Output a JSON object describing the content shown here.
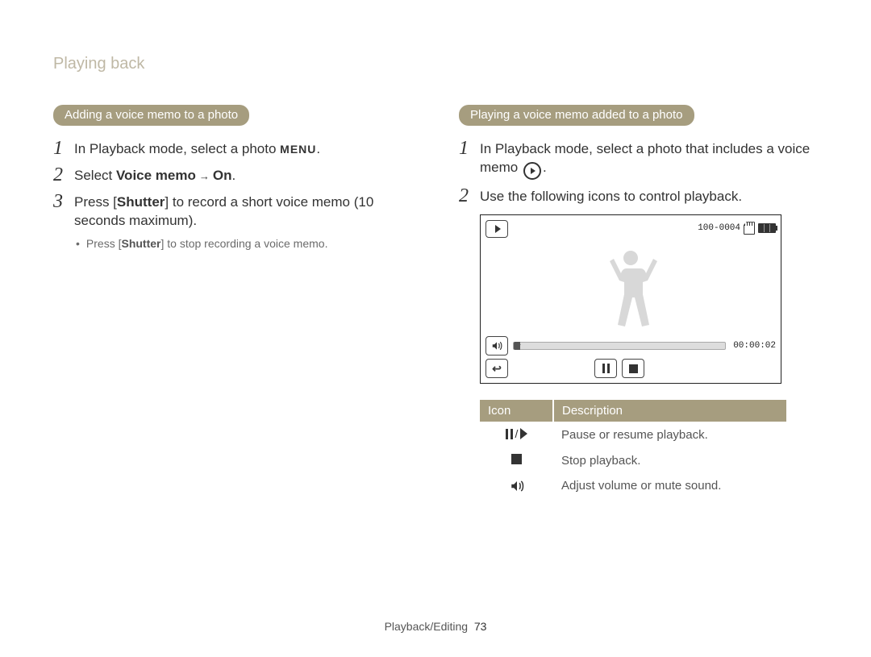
{
  "section_title": "Playing back",
  "left": {
    "heading_pill": "Adding a voice memo to a photo",
    "steps": [
      {
        "num": "1",
        "text_before": "In Playback mode, select a photo ",
        "menu_label": "MENU",
        "text_after": "."
      },
      {
        "num": "2",
        "text_before": "Select ",
        "bold1": "Voice memo",
        "mid": " → ",
        "bold2": "On",
        "text_after": "."
      },
      {
        "num": "3",
        "text_before": "Press [",
        "bold1": "Shutter",
        "text_after": "] to record a short voice memo (10 seconds maximum)."
      }
    ],
    "sub_bullet_before": "Press [",
    "sub_bullet_bold": "Shutter",
    "sub_bullet_after": "] to stop recording a voice memo."
  },
  "right": {
    "heading_pill": "Playing a voice memo added to a photo",
    "steps": [
      {
        "num": "1",
        "text_before": "In Playback mode, select a photo that includes a voice memo ",
        "text_after": "."
      },
      {
        "num": "2",
        "text": "Use the following icons to control playback."
      }
    ],
    "display": {
      "file_number": "100-0004",
      "timecode": "00:00:02"
    },
    "table": {
      "header_icon": "Icon",
      "header_desc": "Description",
      "rows": [
        {
          "desc": "Pause or resume playback."
        },
        {
          "desc": "Stop playback."
        },
        {
          "desc": "Adjust volume or mute sound."
        }
      ]
    }
  },
  "footer": {
    "section": "Playback/Editing",
    "page": "73"
  }
}
